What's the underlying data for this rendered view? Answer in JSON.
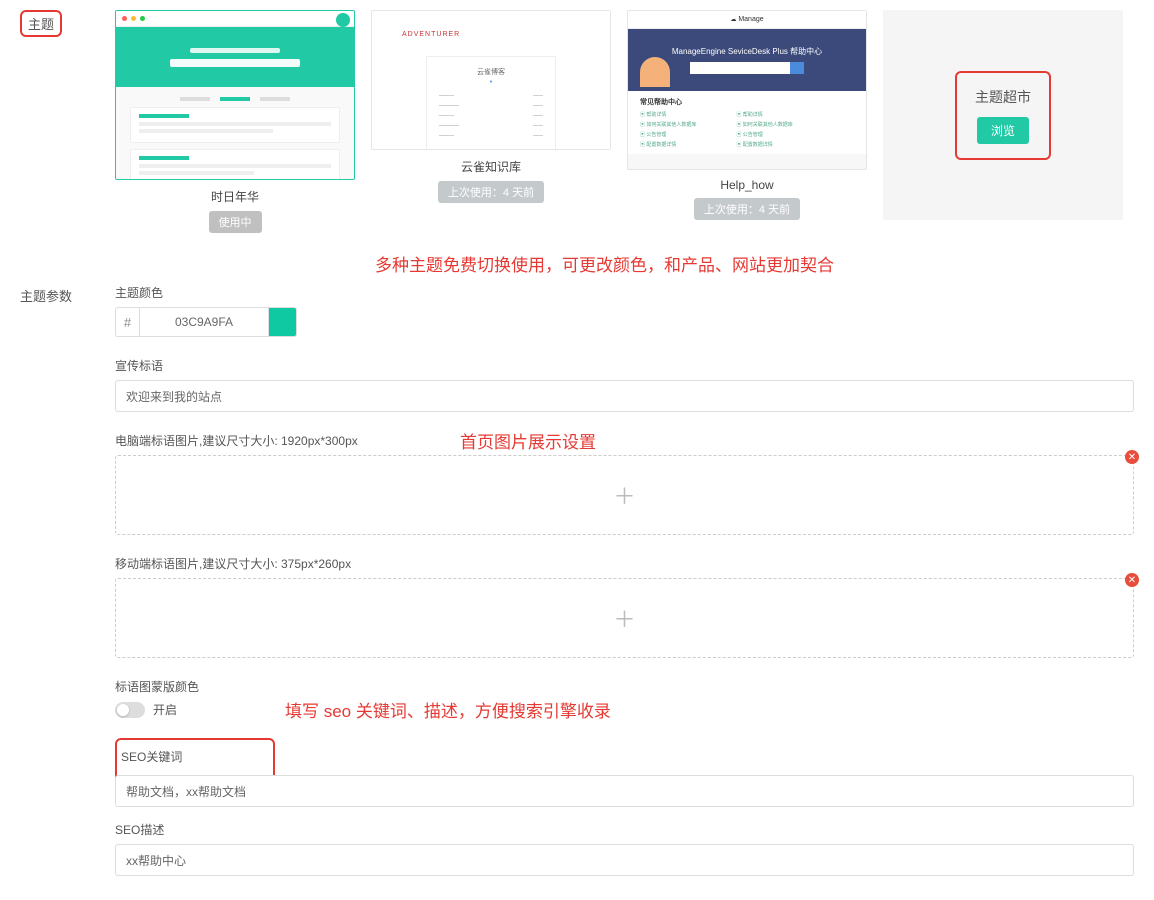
{
  "sidebar": {
    "theme_label": "主题",
    "params_label": "主题参数"
  },
  "themes": [
    {
      "name": "时日年华",
      "badge": "使用中"
    },
    {
      "name": "云雀知识库",
      "badge": "上次使用：4 天前"
    },
    {
      "name": "Help_how",
      "badge": "上次使用：4 天前"
    }
  ],
  "market": {
    "title": "主题超市",
    "browse": "浏览"
  },
  "annotations": {
    "a1": "多种主题免费切换使用，可更改颜色，和产品、网站更加契合",
    "a2": "首页图片展示设置",
    "a3": "填写 seo 关键词、描述，方便搜索引擎收录"
  },
  "form": {
    "color_label": "主题颜色",
    "color_prefix": "#",
    "color_value": "03C9A9FA",
    "slogan_label": "宣传标语",
    "slogan_value": "欢迎来到我的站点",
    "pc_banner_label": "电脑端标语图片,建议尺寸大小: 1920px*300px",
    "mobile_banner_label": "移动端标语图片,建议尺寸大小: 375px*260px",
    "mask_color_label": "标语图蒙版颜色",
    "toggle_label": "开启",
    "seo_kw_label": "SEO关键词",
    "seo_kw_value": "帮助文档，xx帮助文档",
    "seo_desc_label": "SEO描述",
    "seo_desc_value": "xx帮助中心"
  },
  "thumb3": {
    "brand": "Manage",
    "hero": "ManageEngine SeviceDesk Plus 帮助中心",
    "section": "常见帮助中心"
  }
}
